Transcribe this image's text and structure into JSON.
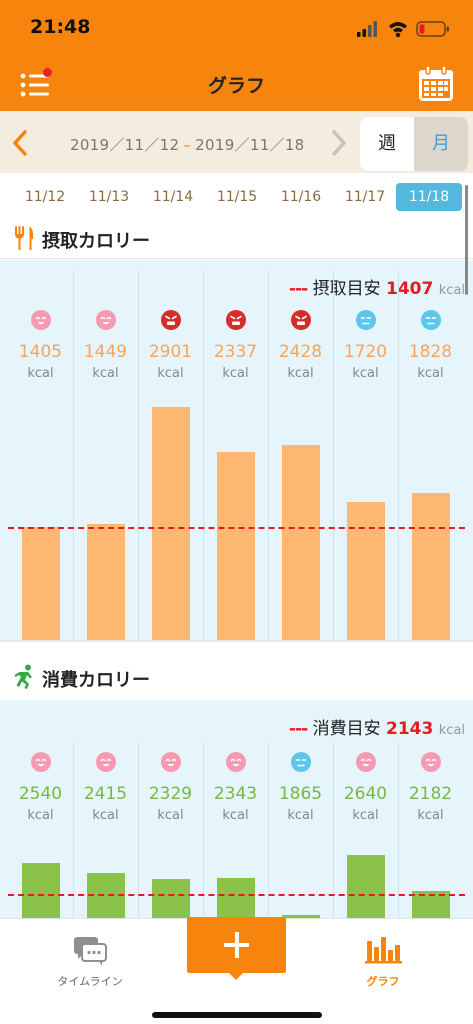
{
  "status": {
    "time": "21:48"
  },
  "header": {
    "title": "グラフ"
  },
  "period": {
    "start": "2019／11／12",
    "separator": "–",
    "end": "2019／11／18",
    "week_label": "週",
    "month_label": "月"
  },
  "days": [
    "11/12",
    "11/13",
    "11/14",
    "11/15",
    "11/16",
    "11/17",
    "11/18"
  ],
  "active_day": "11/18",
  "intake": {
    "title": "摂取カロリー",
    "target_dash": "---",
    "target_label": "摂取目安",
    "target_value": "1407",
    "target_unit": "kcal",
    "value_color": "#f6a55c",
    "bar_color": "#ffb871",
    "faces": [
      "pink",
      "pink",
      "red",
      "red",
      "red",
      "blue",
      "blue"
    ],
    "values": [
      "1405",
      "1449",
      "2901",
      "2337",
      "2428",
      "1720",
      "1828"
    ],
    "unit": "kcal"
  },
  "burn": {
    "title": "消費カロリー",
    "target_dash": "---",
    "target_label": "消費目安",
    "target_value": "2143",
    "target_unit": "kcal",
    "value_color": "#77b841",
    "bar_color": "#8bc34a",
    "faces": [
      "pink",
      "pink",
      "pink",
      "pink",
      "blue",
      "pink",
      "pink"
    ],
    "values": [
      "2540",
      "2415",
      "2329",
      "2343",
      "1865",
      "2640",
      "2182"
    ],
    "unit": "kcal"
  },
  "chart_data": [
    {
      "type": "bar",
      "title": "摂取カロリー",
      "categories": [
        "11/12",
        "11/13",
        "11/14",
        "11/15",
        "11/16",
        "11/17",
        "11/18"
      ],
      "values": [
        1405,
        1449,
        2901,
        2337,
        2428,
        1720,
        1828
      ],
      "reference_line": {
        "label": "摂取目安",
        "value": 1407
      },
      "ylabel": "kcal",
      "grid": false
    },
    {
      "type": "bar",
      "title": "消費カロリー",
      "categories": [
        "11/12",
        "11/13",
        "11/14",
        "11/15",
        "11/16",
        "11/17",
        "11/18"
      ],
      "values": [
        2540,
        2415,
        2329,
        2343,
        1865,
        2640,
        2182
      ],
      "reference_line": {
        "label": "消費目安",
        "value": 2143
      },
      "ylabel": "kcal",
      "grid": false
    }
  ],
  "tabbar": {
    "timeline_label": "タイムライン",
    "graph_label": "グラフ"
  },
  "colors": {
    "brand": "#f7850d",
    "accent_blue": "#54b7dc",
    "target_red": "#e51b23"
  },
  "icons": {
    "menu": "hamburger-menu-icon",
    "calendar": "calendar-icon",
    "prev": "chevron-left-icon",
    "next": "chevron-right-icon",
    "intake": "fork-knife-icon",
    "burn": "runner-icon",
    "timeline": "chat-bubbles-icon",
    "add": "plus-icon",
    "graph": "bar-chart-icon"
  }
}
